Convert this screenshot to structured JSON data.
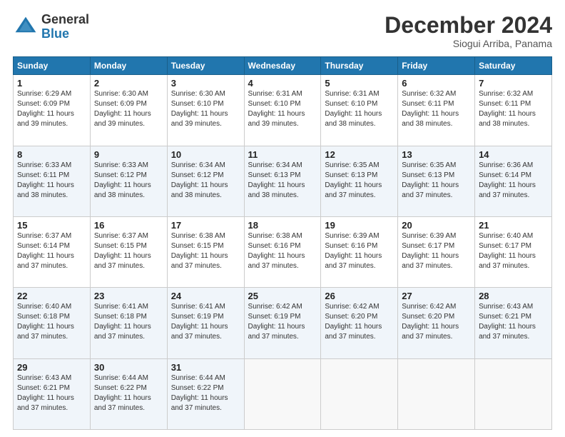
{
  "logo": {
    "general": "General",
    "blue": "Blue"
  },
  "title": "December 2024",
  "location": "Siogui Arriba, Panama",
  "days_of_week": [
    "Sunday",
    "Monday",
    "Tuesday",
    "Wednesday",
    "Thursday",
    "Friday",
    "Saturday"
  ],
  "weeks": [
    [
      {
        "day": "1",
        "sunrise": "6:29 AM",
        "sunset": "6:09 PM",
        "daylight": "11 hours and 39 minutes."
      },
      {
        "day": "2",
        "sunrise": "6:30 AM",
        "sunset": "6:09 PM",
        "daylight": "11 hours and 39 minutes."
      },
      {
        "day": "3",
        "sunrise": "6:30 AM",
        "sunset": "6:10 PM",
        "daylight": "11 hours and 39 minutes."
      },
      {
        "day": "4",
        "sunrise": "6:31 AM",
        "sunset": "6:10 PM",
        "daylight": "11 hours and 39 minutes."
      },
      {
        "day": "5",
        "sunrise": "6:31 AM",
        "sunset": "6:10 PM",
        "daylight": "11 hours and 38 minutes."
      },
      {
        "day": "6",
        "sunrise": "6:32 AM",
        "sunset": "6:11 PM",
        "daylight": "11 hours and 38 minutes."
      },
      {
        "day": "7",
        "sunrise": "6:32 AM",
        "sunset": "6:11 PM",
        "daylight": "11 hours and 38 minutes."
      }
    ],
    [
      {
        "day": "8",
        "sunrise": "6:33 AM",
        "sunset": "6:11 PM",
        "daylight": "11 hours and 38 minutes."
      },
      {
        "day": "9",
        "sunrise": "6:33 AM",
        "sunset": "6:12 PM",
        "daylight": "11 hours and 38 minutes."
      },
      {
        "day": "10",
        "sunrise": "6:34 AM",
        "sunset": "6:12 PM",
        "daylight": "11 hours and 38 minutes."
      },
      {
        "day": "11",
        "sunrise": "6:34 AM",
        "sunset": "6:13 PM",
        "daylight": "11 hours and 38 minutes."
      },
      {
        "day": "12",
        "sunrise": "6:35 AM",
        "sunset": "6:13 PM",
        "daylight": "11 hours and 37 minutes."
      },
      {
        "day": "13",
        "sunrise": "6:35 AM",
        "sunset": "6:13 PM",
        "daylight": "11 hours and 37 minutes."
      },
      {
        "day": "14",
        "sunrise": "6:36 AM",
        "sunset": "6:14 PM",
        "daylight": "11 hours and 37 minutes."
      }
    ],
    [
      {
        "day": "15",
        "sunrise": "6:37 AM",
        "sunset": "6:14 PM",
        "daylight": "11 hours and 37 minutes."
      },
      {
        "day": "16",
        "sunrise": "6:37 AM",
        "sunset": "6:15 PM",
        "daylight": "11 hours and 37 minutes."
      },
      {
        "day": "17",
        "sunrise": "6:38 AM",
        "sunset": "6:15 PM",
        "daylight": "11 hours and 37 minutes."
      },
      {
        "day": "18",
        "sunrise": "6:38 AM",
        "sunset": "6:16 PM",
        "daylight": "11 hours and 37 minutes."
      },
      {
        "day": "19",
        "sunrise": "6:39 AM",
        "sunset": "6:16 PM",
        "daylight": "11 hours and 37 minutes."
      },
      {
        "day": "20",
        "sunrise": "6:39 AM",
        "sunset": "6:17 PM",
        "daylight": "11 hours and 37 minutes."
      },
      {
        "day": "21",
        "sunrise": "6:40 AM",
        "sunset": "6:17 PM",
        "daylight": "11 hours and 37 minutes."
      }
    ],
    [
      {
        "day": "22",
        "sunrise": "6:40 AM",
        "sunset": "6:18 PM",
        "daylight": "11 hours and 37 minutes."
      },
      {
        "day": "23",
        "sunrise": "6:41 AM",
        "sunset": "6:18 PM",
        "daylight": "11 hours and 37 minutes."
      },
      {
        "day": "24",
        "sunrise": "6:41 AM",
        "sunset": "6:19 PM",
        "daylight": "11 hours and 37 minutes."
      },
      {
        "day": "25",
        "sunrise": "6:42 AM",
        "sunset": "6:19 PM",
        "daylight": "11 hours and 37 minutes."
      },
      {
        "day": "26",
        "sunrise": "6:42 AM",
        "sunset": "6:20 PM",
        "daylight": "11 hours and 37 minutes."
      },
      {
        "day": "27",
        "sunrise": "6:42 AM",
        "sunset": "6:20 PM",
        "daylight": "11 hours and 37 minutes."
      },
      {
        "day": "28",
        "sunrise": "6:43 AM",
        "sunset": "6:21 PM",
        "daylight": "11 hours and 37 minutes."
      }
    ],
    [
      {
        "day": "29",
        "sunrise": "6:43 AM",
        "sunset": "6:21 PM",
        "daylight": "11 hours and 37 minutes."
      },
      {
        "day": "30",
        "sunrise": "6:44 AM",
        "sunset": "6:22 PM",
        "daylight": "11 hours and 37 minutes."
      },
      {
        "day": "31",
        "sunrise": "6:44 AM",
        "sunset": "6:22 PM",
        "daylight": "11 hours and 37 minutes."
      },
      null,
      null,
      null,
      null
    ]
  ]
}
